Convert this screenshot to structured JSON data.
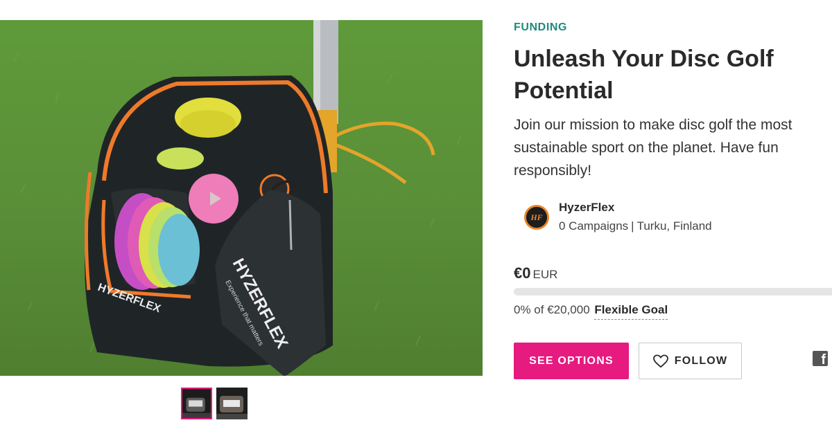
{
  "campaign": {
    "category": "FUNDING",
    "title": "Unleash Your Disc Golf Potential",
    "blurb": "Join our mission to make disc golf the most sustainable sport on the planet. Have fun responsibly!"
  },
  "owner": {
    "name": "HyzerFlex",
    "campaigns": "0 Campaigns",
    "separator": "|",
    "location": "Turku, Finland",
    "avatar_initials": "HF"
  },
  "funding": {
    "raised": "€0",
    "currency": "EUR",
    "progress_fraction": 0,
    "percent_text": "0% of €20,000",
    "goal_type": "Flexible Goal"
  },
  "actions": {
    "see_options": "SEE OPTIONS",
    "follow": "FOLLOW"
  },
  "share": {
    "facebook_glyph": "f"
  },
  "media": {
    "bag_brand": "HYZERFLEX",
    "towel_brand": "HYZERFLEX",
    "towel_tagline": "Experience that matters",
    "thumbnail_count": 2,
    "active_thumbnail": 1
  },
  "colors": {
    "accent": "#e61a7f",
    "category": "#1d8a7c",
    "play_button": "#ee7db9",
    "grass": "#5c8f3a",
    "bag_trim": "#e8872a"
  },
  "icons": {
    "play": "play-icon",
    "heart": "heart-icon",
    "facebook": "facebook-icon",
    "avatar": "hyzerflex-logo"
  }
}
